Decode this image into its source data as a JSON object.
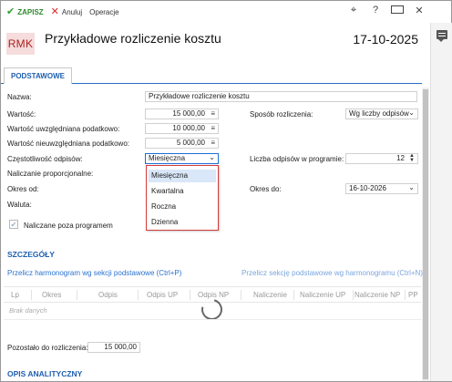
{
  "toolbar": {
    "save_label": "ZAPISZ",
    "cancel_label": "Anuluj",
    "operations_label": "Operacje",
    "save_icon": "✔",
    "cancel_icon": "✕",
    "help_icon": "?",
    "close_icon": "✕",
    "pin_icon": "⌖"
  },
  "header": {
    "badge": "RMK",
    "title": "Przykładowe rozliczenie kosztu",
    "date": "17-10-2025"
  },
  "tabs": [
    {
      "label": "PODSTAWOWE"
    }
  ],
  "form": {
    "name_label": "Nazwa:",
    "name_value": "Przykładowe rozliczenie kosztu",
    "value_label": "Wartość:",
    "value_value": "15 000,00",
    "taxable_label": "Wartość uwzględniana podatkowo:",
    "taxable_value": "10 000,00",
    "nontaxable_label": "Wartość nieuwzględniana podatkowo:",
    "nontaxable_value": "5 000,00",
    "freq_label": "Częstotliwość odpisów:",
    "freq_value": "Miesięczna",
    "proportional_label": "Naliczanie proporcjonalne:",
    "period_from_label": "Okres od:",
    "currency_label": "Waluta:",
    "method_label": "Sposób rozliczenia:",
    "method_value": "Wg liczby odpisów",
    "count_label": "Liczba odpisów w programie:",
    "count_value": "12",
    "period_to_label": "Okres do:",
    "period_to_value": "16-10-2026",
    "outside_label": "Naliczane poza programem",
    "calc_icon": "≡"
  },
  "dropdown": {
    "options": [
      "Miesięczna",
      "Kwartalna",
      "Roczna",
      "Dzienna"
    ],
    "selected": "Miesięczna"
  },
  "details": {
    "heading": "SZCZEGÓŁY",
    "link_left": "Przelicz harmonogram wg sekcji podstawowe (Ctrl+P)",
    "link_right": "Przelicz sekcję podstawowe wg harmonogramu (Ctrl+N)",
    "columns": [
      "Lp",
      "Okres",
      "Odpis",
      "Odpis UP",
      "Odpis NP",
      "Naliczenie",
      "Naliczenie UP",
      "Naliczenie NP",
      "PP"
    ],
    "empty_text": "Brak danych",
    "remaining_label": "Pozostało do rozliczenia:",
    "remaining_value": "15 000,00"
  },
  "analytics": {
    "heading": "OPIS ANALITYCZNY"
  },
  "colors": {
    "accent": "#1f5fb0",
    "save": "#2e9e2e",
    "cancel": "#d62b2b",
    "dropdown_border": "#d33b3b"
  }
}
